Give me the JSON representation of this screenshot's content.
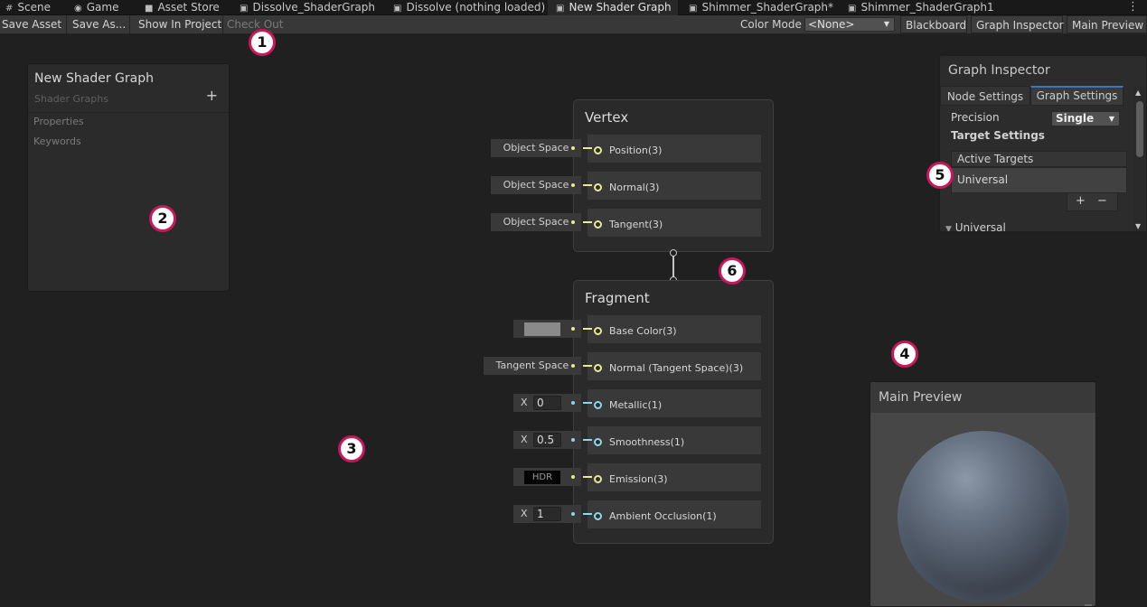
{
  "tabs": [
    {
      "label": "Scene",
      "icon": "grid-icon"
    },
    {
      "label": "Game",
      "icon": "gamepad-icon"
    },
    {
      "label": "Asset Store",
      "icon": "bag-icon"
    },
    {
      "label": "Dissolve_ShaderGraph",
      "icon": "shader-graph-icon"
    },
    {
      "label": "Dissolve (nothing loaded)",
      "icon": "shader-graph-icon"
    },
    {
      "label": "New Shader Graph",
      "icon": "shader-graph-icon",
      "active": true
    },
    {
      "label": "Shimmer_ShaderGraph*",
      "icon": "shader-graph-icon"
    },
    {
      "label": "Shimmer_ShaderGraph1",
      "icon": "shader-graph-icon"
    }
  ],
  "toolbar": {
    "save_asset": "Save Asset",
    "save_as": "Save As...",
    "show_in_project": "Show In Project",
    "check_out": "Check Out",
    "color_mode_label": "Color Mode",
    "color_mode_value": "<None>",
    "blackboard": "Blackboard",
    "graph_inspector": "Graph Inspector",
    "main_preview": "Main Preview"
  },
  "blackboard": {
    "title": "New Shader Graph",
    "subtitle": "Shader Graphs",
    "add": "+",
    "sections": [
      "Properties",
      "Keywords"
    ]
  },
  "vertex": {
    "title": "Vertex",
    "blocks": [
      {
        "label": "Position(3)",
        "input": "Object Space"
      },
      {
        "label": "Normal(3)",
        "input": "Object Space"
      },
      {
        "label": "Tangent(3)",
        "input": "Object Space"
      }
    ]
  },
  "fragment": {
    "title": "Fragment",
    "blocks": [
      {
        "label": "Base Color(3)",
        "input_type": "color",
        "color": "#8a8a8a"
      },
      {
        "label": "Normal (Tangent Space)(3)",
        "input": "Tangent Space"
      },
      {
        "label": "Metallic(1)",
        "axis": "X",
        "value": "0"
      },
      {
        "label": "Smoothness(1)",
        "axis": "X",
        "value": "0.5"
      },
      {
        "label": "Emission(3)",
        "input": "HDR"
      },
      {
        "label": "Ambient Occlusion(1)",
        "axis": "X",
        "value": "1"
      }
    ]
  },
  "inspector": {
    "title": "Graph Inspector",
    "tabs": [
      "Node Settings",
      "Graph Settings"
    ],
    "active_tab": "Graph Settings",
    "precision_label": "Precision",
    "precision_value": "Single",
    "target_settings": "Target Settings",
    "active_targets": "Active Targets",
    "target_item": "Universal",
    "add": "+",
    "remove": "−",
    "foldout": "Universal"
  },
  "preview": {
    "title": "Main Preview"
  },
  "callouts": [
    "1",
    "2",
    "3",
    "4",
    "5",
    "6"
  ],
  "colors": {
    "vector3_port": "#e8ea94",
    "float_port": "#8ed8e9",
    "callout_ring": "#c8185a",
    "tab_accent": "#3a79bb"
  }
}
